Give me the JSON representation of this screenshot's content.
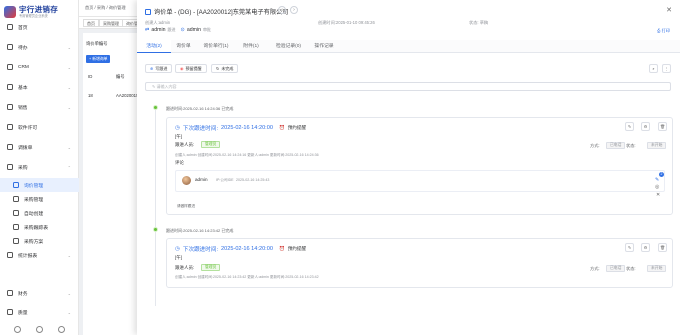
{
  "app": {
    "logo_title": "宇行进销存",
    "logo_subtitle": "专用管理员企业系统",
    "accent": "#2f6fe4"
  },
  "sidebar": {
    "items": [
      {
        "label": "首页",
        "icon": "home-icon"
      },
      {
        "label": "待办",
        "icon": "todo-icon",
        "chevron": "⌄"
      },
      {
        "label": "CRM",
        "icon": "crm-icon",
        "chevron": "⌄"
      },
      {
        "label": "基本",
        "icon": "basic-icon",
        "chevron": "⌄"
      },
      {
        "label": "销售",
        "icon": "sales-icon",
        "chevron": "⌄"
      },
      {
        "label": "软件许可",
        "icon": "license-icon"
      },
      {
        "label": "调拨单",
        "icon": "transfer-icon",
        "chevron": "⌄"
      },
      {
        "label": "采购",
        "icon": "purchase-icon",
        "chevron": "⌃"
      },
      {
        "label": "询价管理",
        "icon": "inquiry-icon",
        "active": true
      },
      {
        "label": "采购管理",
        "icon": "purchase-manage-icon"
      },
      {
        "label": "自动创建",
        "icon": "auto-create-icon"
      },
      {
        "label": "采购跟踪表",
        "icon": "tracking-icon"
      },
      {
        "label": "采购方案",
        "icon": "plan-icon"
      },
      {
        "label": "统计报表",
        "icon": "report-icon",
        "chevron": "⌄"
      },
      {
        "label": "财务",
        "icon": "finance-icon",
        "chevron": "⌄"
      },
      {
        "label": "质量",
        "icon": "quality-icon",
        "chevron": "⌄"
      }
    ]
  },
  "background": {
    "breadcrumb": [
      "首页",
      "采购",
      "询价管理"
    ],
    "tabs": [
      "首页",
      "采购管理",
      "询价管理"
    ],
    "filter_label": "询价单编号",
    "filter_placeholder": "请输入",
    "new_button": "+ 新增询单",
    "col_id": "ID",
    "col_no": "编号",
    "row_id": "18",
    "row_no": "AA2020015"
  },
  "drawer": {
    "title": "询价单 - (DG) - [AA2020012]东莞某电子有限公司",
    "creator_label": "创建人:admin",
    "created_label": "创建时间:2025-01-10 09:45:26",
    "status_label": "状态: 草稿",
    "owner_name": "admin",
    "owner_role": "跟进",
    "approver_name": "admin",
    "approver_role": "审批",
    "print_label": "打印",
    "tabs": [
      "活动(2)",
      "询价单",
      "询价单行(1)",
      "附件(1)",
      "检验记录(0)",
      "操作记录"
    ],
    "actions": {
      "add_label": "写跟进",
      "remind_label": "预留提醒",
      "refresh_label": "未完成"
    },
    "input_placeholder": "请输入内容",
    "activities": [
      {
        "header": "跟进时间:2025-02-16 14:24:36 已完成",
        "next_label": "下次跟进时间:",
        "next_time": "2025-02-16 14:20:00",
        "reminder": "预约提醒",
        "type": "[午]",
        "people_label": "跟进人员:",
        "people_tag": "管理员",
        "meta": "创建人:admin 创建时间:2025-02-16 14:24:16 更新人:admin 更新时间:2025-02-16 14:24:36",
        "method_label": "方式:",
        "method_value": "已电话",
        "status_label": "状态:",
        "status_value": "未开始",
        "comment_section": "评论",
        "comment_user": "admin",
        "comment_ip": "IP:公司IDE",
        "comment_time": "2025-02-16 14:25:43",
        "comment_text": "请做样跟进",
        "badge": "2"
      },
      {
        "header": "跟进时间:2025-02-16 14:23:42 已完成",
        "next_label": "下次跟进时间:",
        "next_time": "2025-02-16 14:20:00",
        "reminder": "预约提醒",
        "type": "[午]",
        "people_label": "跟进人员:",
        "people_tag": "管理员",
        "meta": "创建人:admin 创建时间:2025-02-16 14:23:42 更新人:admin 更新时间:2025-02-16 14:23:42",
        "method_label": "方式:",
        "method_value": "已电话",
        "status_label": "状态:",
        "status_value": "未开始"
      }
    ]
  }
}
